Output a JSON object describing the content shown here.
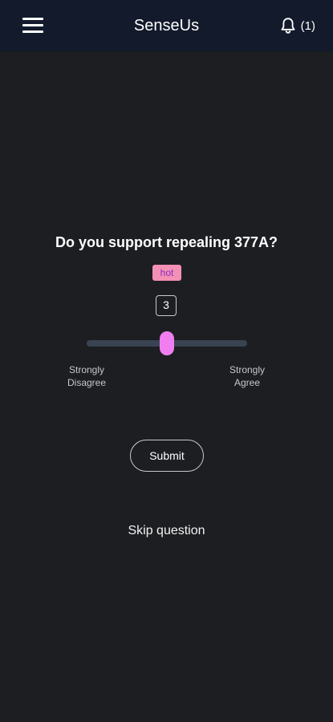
{
  "header": {
    "app_title": "SenseUs",
    "notification_count": "(1)",
    "menu_icon": "hamburger-menu-icon",
    "bell_icon": "bell-icon"
  },
  "question": {
    "text": "Do you support repealing 377A?",
    "tag": "hot",
    "current_value": "3",
    "slider": {
      "min": 1,
      "max": 5,
      "value": 3
    },
    "scale_left_label": "Strongly\nDisagree",
    "scale_right_label": "Strongly\nAgree"
  },
  "actions": {
    "submit_label": "Submit",
    "skip_label": "Skip question"
  },
  "colors": {
    "background": "#1d1e22",
    "header_background": "#121a2b",
    "slider_track": "#3a4352",
    "slider_thumb": "#f07ef0",
    "tag_background": "#f390b4",
    "tag_text": "#8b2dc4"
  }
}
